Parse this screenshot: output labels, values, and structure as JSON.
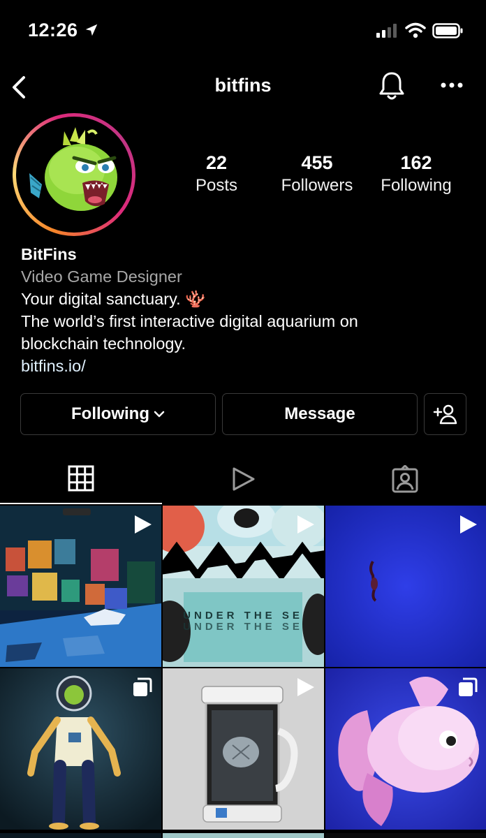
{
  "status_bar": {
    "time": "12:26",
    "icons": [
      "location-arrow-icon",
      "cellular-signal-icon",
      "wifi-icon",
      "battery-icon"
    ]
  },
  "nav": {
    "title": "bitfins",
    "icons": [
      "back-chevron-icon",
      "bell-icon",
      "more-dots-icon"
    ]
  },
  "profile": {
    "stats": [
      {
        "value": "22",
        "label": "Posts"
      },
      {
        "value": "455",
        "label": "Followers"
      },
      {
        "value": "162",
        "label": "Following"
      }
    ],
    "name": "BitFins",
    "category": "Video Game Designer",
    "bio_line1": "Your digital sanctuary. 🪸",
    "bio_line2": "The world’s first interactive digital aquarium on",
    "bio_line3": "blockchain technology.",
    "link": "bitfins.io/"
  },
  "actions": {
    "following_label": "Following",
    "message_label": "Message"
  },
  "tabs": [
    "grid-icon",
    "reels-play-icon",
    "tagged-person-icon"
  ],
  "posts": [
    {
      "type": "reel",
      "desc": "3d-gallery-room"
    },
    {
      "type": "reel",
      "desc": "under-the-sea-pattern",
      "overlay_text": "UNDER THE SE"
    },
    {
      "type": "reel",
      "desc": "blue-background-figure"
    },
    {
      "type": "carousel",
      "desc": "astronaut-fish-character"
    },
    {
      "type": "reel",
      "desc": "aquarium-device"
    },
    {
      "type": "carousel",
      "desc": "pink-goldfish"
    }
  ],
  "colors": {
    "background": "#000000",
    "border": "#3a3a3a",
    "category_text": "#a8a8a8"
  }
}
